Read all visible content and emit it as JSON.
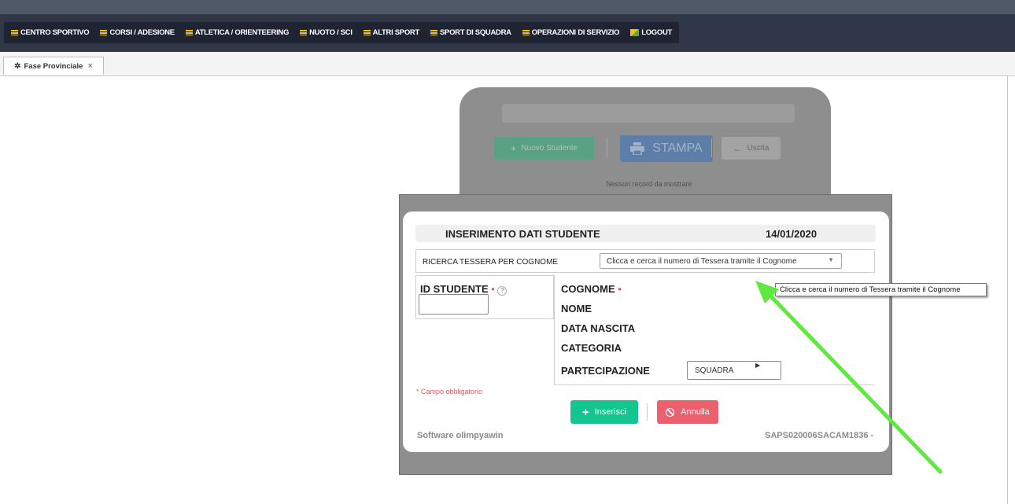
{
  "menu": {
    "items": [
      {
        "label": "CENTRO SPORTIVO"
      },
      {
        "label": "CORSI / ADESIONE"
      },
      {
        "label": "ATLETICA / ORIENTEERING"
      },
      {
        "label": "NUOTO / SCI"
      },
      {
        "label": "ALTRI SPORT"
      },
      {
        "label": "SPORT DI SQUADRA"
      },
      {
        "label": "OPERAZIONI DI SERVIZIO"
      }
    ],
    "logout_label": "LOGOUT"
  },
  "tab": {
    "label": "Fase Provinciale",
    "close": "×"
  },
  "background": {
    "new_student": "Nuovo Studente",
    "print": "STAMPA",
    "exit": "Uscita",
    "no_records": "Nessun record da mostrare"
  },
  "modal": {
    "title": "INSERIMENTO DATI STUDENTE",
    "date": "14/01/2020",
    "search_label": "RICERCA TESSERA PER COGNOME",
    "search_value": "Clicca e cerca il numero di Tessera tramite il Cognome",
    "id_label": "ID STUDENTE",
    "required_mark": "•",
    "help_mark": "?",
    "fields": {
      "surname": "COGNOME",
      "name": "NOME",
      "birth_date": "DATA NASCITA",
      "category": "CATEGORIA",
      "participation": "PARTECIPAZIONE"
    },
    "participation_value": "SQUADRA",
    "mandatory_note": "* Campo obbligatorio",
    "insert_button": "Inserisci",
    "cancel_button": "Annulla",
    "footer_left": "Software olimpyawin",
    "footer_right": "SAPS020006SACAM1836 -"
  },
  "tooltip": {
    "text": "Clicca e cerca il numero di Tessera tramite il Cognome"
  },
  "colors": {
    "menu_bg": "#1e2432",
    "menu_icon": "#f5c400",
    "insert": "#15c58f",
    "cancel": "#ec5f6d",
    "overlay": "#8e8e8e",
    "annotation_arrow": "#5fe83f"
  }
}
